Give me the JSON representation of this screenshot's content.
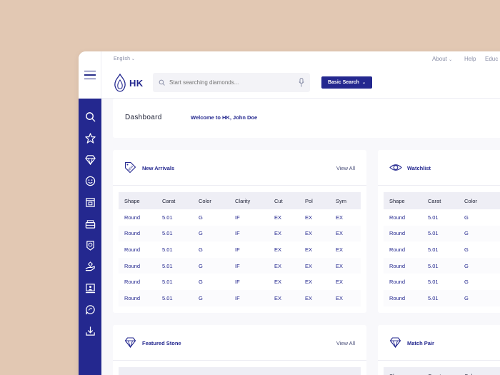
{
  "topbar": {
    "language": "English",
    "links": [
      "About",
      "Help",
      "Educ"
    ],
    "logo_text": "HK",
    "search_placeholder": "Start searching diamonds...",
    "basic_search_label": "Basic Search"
  },
  "sidebar": {
    "items": [
      "search",
      "star",
      "diamond",
      "smiley",
      "box",
      "gift",
      "award",
      "hand-diamond",
      "monitor",
      "chat",
      "download"
    ]
  },
  "dashboard": {
    "title": "Dashboard",
    "welcome": "Welcome to HK, John Doe"
  },
  "new_arrivals": {
    "title": "New Arrivals",
    "view_all": "View All",
    "columns": [
      "Shape",
      "Carat",
      "Color",
      "Clarity",
      "Cut",
      "Pol",
      "Sym"
    ],
    "rows": [
      [
        "Round",
        "5.01",
        "G",
        "IF",
        "EX",
        "EX",
        "EX"
      ],
      [
        "Round",
        "5.01",
        "G",
        "IF",
        "EX",
        "EX",
        "EX"
      ],
      [
        "Round",
        "5.01",
        "G",
        "IF",
        "EX",
        "EX",
        "EX"
      ],
      [
        "Round",
        "5.01",
        "G",
        "IF",
        "EX",
        "EX",
        "EX"
      ],
      [
        "Round",
        "5.01",
        "G",
        "IF",
        "EX",
        "EX",
        "EX"
      ],
      [
        "Round",
        "5.01",
        "G",
        "IF",
        "EX",
        "EX",
        "EX"
      ]
    ]
  },
  "watchlist": {
    "title": "Watchlist",
    "columns": [
      "Shape",
      "Carat",
      "Color"
    ],
    "rows": [
      [
        "Round",
        "5.01",
        "G"
      ],
      [
        "Round",
        "5.01",
        "G"
      ],
      [
        "Round",
        "5.01",
        "G"
      ],
      [
        "Round",
        "5.01",
        "G"
      ],
      [
        "Round",
        "5.01",
        "G"
      ],
      [
        "Round",
        "5.01",
        "G"
      ]
    ]
  },
  "featured_stone": {
    "title": "Featured Stone",
    "view_all": "View All"
  },
  "match_pair": {
    "title": "Match Pair",
    "columns": [
      "Shape",
      "Carat",
      "Color"
    ]
  },
  "colors": {
    "brand": "#24288f",
    "background": "#e2c8b3"
  }
}
